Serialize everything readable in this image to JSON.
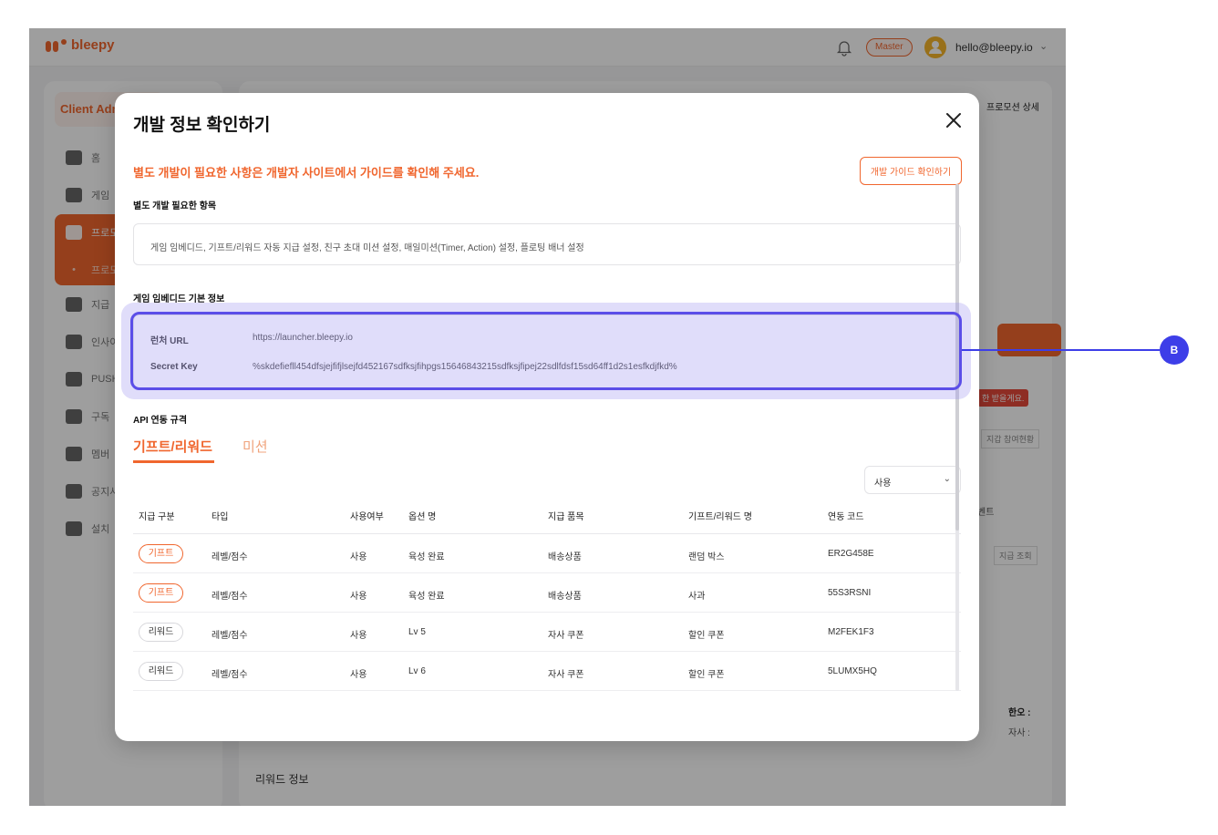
{
  "app": {
    "brand": "bleepy",
    "role_badge": "Master",
    "user_email": "hello@bleepy.io"
  },
  "sidebar": {
    "client_label": "Client Adm",
    "items": [
      {
        "label": "홈"
      },
      {
        "label": "게임"
      },
      {
        "label": "프로모"
      },
      {
        "label": "프로모"
      },
      {
        "label": "지급"
      },
      {
        "label": "인사이"
      },
      {
        "label": "PUSH"
      },
      {
        "label": "구독"
      },
      {
        "label": "멤버"
      },
      {
        "label": "공지사"
      },
      {
        "label": "설치"
      }
    ]
  },
  "background": {
    "breadcrumb_tail": "프로모션 상세",
    "tag_red": "한 받을게요.",
    "btn_small": "지갑 참여현황",
    "ent_label": "벤트",
    "btn_small2": "지급 조회",
    "side_promo_a": "한오 :",
    "side_promo_b": "자사 :",
    "reward_section": "리워드 정보"
  },
  "modal": {
    "title": "개발 정보 확인하기",
    "notice": "별도 개발이 필요한 사항은 개발자 사이트에서 가이드를 확인해 주세요.",
    "guide_button": "개발 가이드 확인하기",
    "required_section_label": "별도 개발 필요한 항목",
    "required_items": "게임 임베디드, 기프트/리워드 자동 지급 설정, 친구 초대 미션 설정, 매일미션(Timer, Action) 설정, 플로팅 배너 설정",
    "embed_section_label": "게임 임베디드 기본 정보",
    "launcher_url_key": "런처 URL",
    "launcher_url_value": "https://launcher.bleepy.io",
    "secret_key_key": "Secret Key",
    "secret_key_value": "%skdefiefll454dfsjejfifjlsejfd452167sdfksjfihpgs15646843215sdfksjfipej22sdlfdsf15sd64ff1d2s1esfkdjfkd%",
    "api_section_label": "API 연동 규격",
    "tabs": [
      {
        "label": "기프트/리워드",
        "active": true
      },
      {
        "label": "미션",
        "active": false
      }
    ],
    "filter_select": "사용",
    "table": {
      "headers": [
        "지급 구분",
        "타입",
        "사용여부",
        "옵션 명",
        "지급 품목",
        "기프트/리워드 명",
        "연동 코드"
      ],
      "rows": [
        {
          "kind": "기프트",
          "type": "레벨/점수",
          "use": "사용",
          "option": "육성 완료",
          "item": "배송상품",
          "name": "랜덤 박스",
          "code": "ER2G458E"
        },
        {
          "kind": "기프트",
          "type": "레벨/점수",
          "use": "사용",
          "option": "육성 완료",
          "item": "배송상품",
          "name": "사과",
          "code": "55S3RSNI"
        },
        {
          "kind": "리워드",
          "type": "레벨/점수",
          "use": "사용",
          "option": "Lv 5",
          "item": "자사 쿠폰",
          "name": "할인 쿠폰",
          "code": "M2FEK1F3"
        },
        {
          "kind": "리워드",
          "type": "레벨/점수",
          "use": "사용",
          "option": "Lv 6",
          "item": "자사 쿠폰",
          "name": "할인 쿠폰",
          "code": "5LUMX5HQ"
        }
      ]
    }
  },
  "annotation": {
    "marker": "B"
  },
  "colors": {
    "accent": "#f0662e",
    "highlight": "#5b4ee8",
    "marker": "#3d3ee8"
  }
}
